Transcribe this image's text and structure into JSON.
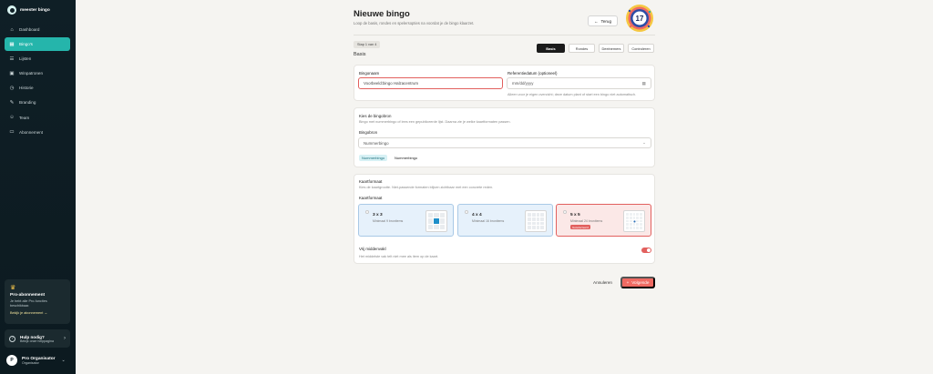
{
  "app": {
    "name": "meester bingo"
  },
  "sidebar": {
    "items": [
      {
        "label": "Dashboard",
        "icon": "home-icon"
      },
      {
        "label": "Bingo's",
        "icon": "grid-icon",
        "active": true
      },
      {
        "label": "Lijsten",
        "icon": "list-icon"
      },
      {
        "label": "Winpatronen",
        "icon": "pattern-icon"
      },
      {
        "label": "Historie",
        "icon": "history-icon"
      },
      {
        "label": "Branding",
        "icon": "brush-icon"
      },
      {
        "label": "Team",
        "icon": "users-icon"
      },
      {
        "label": "Abonnement",
        "icon": "card-icon"
      }
    ],
    "pro": {
      "title": "Pro-abonnement",
      "desc": "Je hebt alle Pro-functies beschikbaar.",
      "link": "Bekijk je abonnement"
    },
    "help": {
      "title": "Hulp nodig?",
      "sub": "Bekijk onze helppagina"
    },
    "user": {
      "initial": "P",
      "name": "Pro Organisator",
      "role": "Organisator"
    }
  },
  "header": {
    "title": "Nieuwe bingo",
    "subtitle": "Loop de basis, rondes en spelersopties na voordat je de bingo klaarzet.",
    "back_label": "Terug",
    "ball_number": "17"
  },
  "wizard": {
    "step": "Stap 1 van 4",
    "section": "Basis",
    "tabs": [
      "Basis",
      "Rondes",
      "Deelnemers",
      "Controleren"
    ]
  },
  "form": {
    "name": {
      "label": "Bingonaam",
      "placeholder": "Voorbeeld:bingo Halzacentrum"
    },
    "date": {
      "label": "Referentiedatum (optioneel)",
      "placeholder": "mm/dd/yyyy",
      "hint": "Alleen voor je eigen overzicht; deze datum plant of start een bingo niet automatisch."
    }
  },
  "source": {
    "title": "Kies de bingobron",
    "desc": "Bingo met nummerbingo of lees een gepubliceerde lijst. Daarna zie je welke kaartformaten passen.",
    "select_label": "Bingobron",
    "select_value": "Nummerbingo",
    "chips": [
      "Nummerbingo",
      "Nummerbingo"
    ]
  },
  "format": {
    "title": "Kaartformaat",
    "desc": "Kies de kaartgrootte. Niet-passende formaten blijven zichtbaar met een concrete reden.",
    "label": "Kaartformaat",
    "options": [
      {
        "title": "3 x 3",
        "sub": "Minimaal 9 bronitems"
      },
      {
        "title": "4 x 4",
        "sub": "Minimaal 16 bronitems"
      },
      {
        "title": "5 x 5",
        "sub": "Minimaal 24 bronitems",
        "badge": "Geselecteerd"
      }
    ],
    "free_center": {
      "label": "Vrij middenvakl",
      "hint": "Het middelste vak telt niet mee als item op de kaart.",
      "enabled": true
    }
  },
  "footer": {
    "cancel": "Annuleren",
    "next": "Volgende"
  },
  "colors": {
    "accent": "#25b5ab",
    "danger": "#e2605e",
    "sidebar": "#0f1f26"
  }
}
